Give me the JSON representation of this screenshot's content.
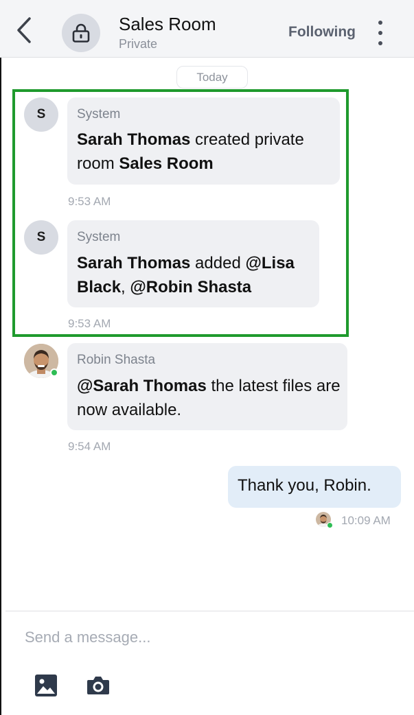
{
  "header": {
    "title": "Sales Room",
    "subtitle": "Private",
    "following_label": "Following",
    "back_icon": "chevron-left-icon",
    "room_icon": "lock-icon",
    "menu_icon": "more-vertical-icon"
  },
  "date_divider": "Today",
  "messages": [
    {
      "sender": "System",
      "avatar_letter": "S",
      "parts": [
        {
          "bold": true,
          "text": "Sarah Thomas"
        },
        {
          "bold": false,
          "text": " created private room "
        },
        {
          "bold": true,
          "text": "Sales Room"
        }
      ],
      "time": "9:53 AM"
    },
    {
      "sender": "System",
      "avatar_letter": "S",
      "parts": [
        {
          "bold": true,
          "text": "Sarah Thomas"
        },
        {
          "bold": false,
          "text": " added "
        },
        {
          "bold": true,
          "text": "@Lisa Black"
        },
        {
          "bold": false,
          "text": ", "
        },
        {
          "bold": true,
          "text": "@Robin Shasta"
        }
      ],
      "time": "9:53 AM"
    },
    {
      "sender": "Robin Shasta",
      "avatar_photo": true,
      "online": true,
      "parts": [
        {
          "bold": true,
          "text": "@Sarah Thomas"
        },
        {
          "bold": false,
          "text": " the latest files are now available."
        }
      ],
      "time": "9:54 AM"
    }
  ],
  "my_message": {
    "text": "Thank you, Robin.",
    "time": "10:09 AM"
  },
  "composer": {
    "placeholder": "Send a message...",
    "image_icon": "image-icon",
    "camera_icon": "camera-icon"
  },
  "colors": {
    "highlight": "#1f9a2d",
    "online": "#2ebd55",
    "my_bubble": "#e2edf8",
    "bubble": "#eff0f3"
  }
}
